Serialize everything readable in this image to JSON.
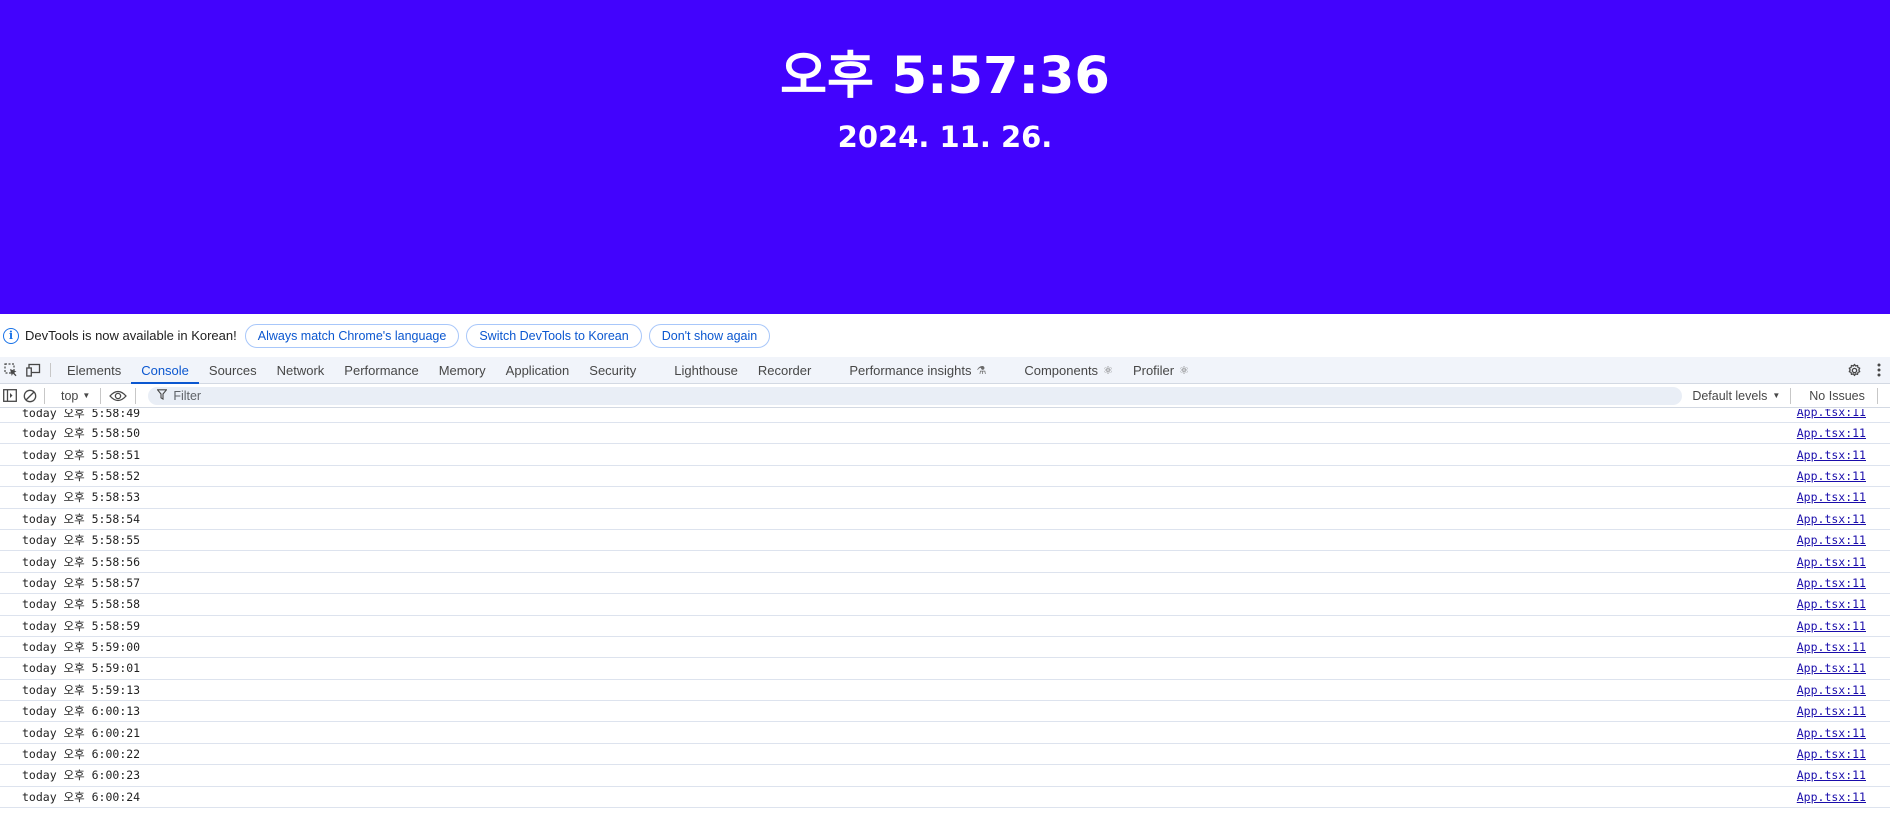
{
  "app": {
    "time": "오후 5:57:36",
    "date": "2024. 11. 26.",
    "background_color": "#4203fd"
  },
  "devtools": {
    "infobar": {
      "icon": "info-icon",
      "message": "DevTools is now available in Korean!",
      "buttons": [
        "Always match Chrome's language",
        "Switch DevTools to Korean",
        "Don't show again"
      ]
    },
    "tabs": [
      {
        "label": "Elements",
        "active": false,
        "suffix": ""
      },
      {
        "label": "Console",
        "active": true,
        "suffix": ""
      },
      {
        "label": "Sources",
        "active": false,
        "suffix": ""
      },
      {
        "label": "Network",
        "active": false,
        "suffix": ""
      },
      {
        "label": "Performance",
        "active": false,
        "suffix": ""
      },
      {
        "label": "Memory",
        "active": false,
        "suffix": ""
      },
      {
        "label": "Application",
        "active": false,
        "suffix": ""
      },
      {
        "label": "Security",
        "active": false,
        "suffix": ""
      },
      {
        "label": "Lighthouse",
        "active": false,
        "suffix": ""
      },
      {
        "label": "Recorder",
        "active": false,
        "suffix": ""
      },
      {
        "label": "Performance insights",
        "active": false,
        "suffix": "flask-icon"
      },
      {
        "label": "Components",
        "active": false,
        "suffix": "react-icon"
      },
      {
        "label": "Profiler",
        "active": false,
        "suffix": "react-icon"
      }
    ],
    "toolbar": {
      "context": "top",
      "filter_placeholder": "Filter",
      "levels": "Default levels",
      "issues": "No Issues"
    },
    "messages": [
      {
        "text": "today 오후 5:58:49",
        "source": "App.tsx:11"
      },
      {
        "text": "today 오후 5:58:50",
        "source": "App.tsx:11"
      },
      {
        "text": "today 오후 5:58:51",
        "source": "App.tsx:11"
      },
      {
        "text": "today 오후 5:58:52",
        "source": "App.tsx:11"
      },
      {
        "text": "today 오후 5:58:53",
        "source": "App.tsx:11"
      },
      {
        "text": "today 오후 5:58:54",
        "source": "App.tsx:11"
      },
      {
        "text": "today 오후 5:58:55",
        "source": "App.tsx:11"
      },
      {
        "text": "today 오후 5:58:56",
        "source": "App.tsx:11"
      },
      {
        "text": "today 오후 5:58:57",
        "source": "App.tsx:11"
      },
      {
        "text": "today 오후 5:58:58",
        "source": "App.tsx:11"
      },
      {
        "text": "today 오후 5:58:59",
        "source": "App.tsx:11"
      },
      {
        "text": "today 오후 5:59:00",
        "source": "App.tsx:11"
      },
      {
        "text": "today 오후 5:59:01",
        "source": "App.tsx:11"
      },
      {
        "text": "today 오후 5:59:13",
        "source": "App.tsx:11"
      },
      {
        "text": "today 오후 6:00:13",
        "source": "App.tsx:11"
      },
      {
        "text": "today 오후 6:00:21",
        "source": "App.tsx:11"
      },
      {
        "text": "today 오후 6:00:22",
        "source": "App.tsx:11"
      },
      {
        "text": "today 오후 6:00:23",
        "source": "App.tsx:11"
      },
      {
        "text": "today 오후 6:00:24",
        "source": "App.tsx:11"
      }
    ]
  }
}
